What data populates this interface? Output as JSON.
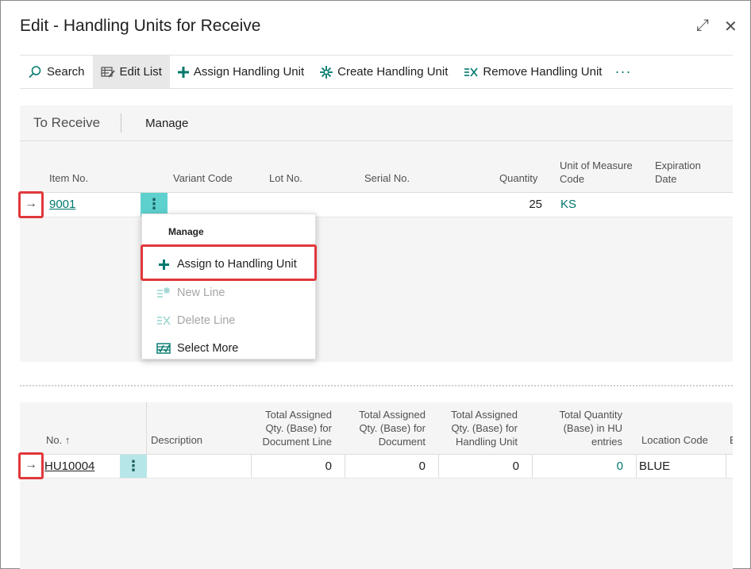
{
  "window": {
    "title": "Edit - Handling Units for Receive",
    "expand_icon": "⤢",
    "close_icon": "✕"
  },
  "toolbar": {
    "search_label": "Search",
    "edit_list_label": "Edit List",
    "assign_label": "Assign Handling Unit",
    "create_label": "Create Handling Unit",
    "remove_label": "Remove Handling Unit",
    "more_label": "···"
  },
  "to_receive": {
    "title": "To Receive",
    "manage_label": "Manage",
    "columns": {
      "item_no": "Item No.",
      "variant_code": "Variant Code",
      "lot_no": "Lot No.",
      "serial_no": "Serial No.",
      "quantity": "Quantity",
      "uom_line1": "Unit of Measure",
      "uom_line2": "Code",
      "exp_line1": "Expiration",
      "exp_line2": "Date"
    },
    "row": {
      "item_no": "9001",
      "quantity": "25",
      "uom": "KS"
    }
  },
  "context_menu": {
    "title": "Manage",
    "items": [
      {
        "label": "Assign to Handling Unit",
        "enabled": true
      },
      {
        "label": "New Line",
        "enabled": false
      },
      {
        "label": "Delete Line",
        "enabled": false
      },
      {
        "label": "Select More",
        "enabled": true
      }
    ]
  },
  "handling_units": {
    "columns": {
      "no": "No. ↑",
      "description": "Description",
      "doc_line_1": "Total Assigned",
      "doc_line_2": "Qty. (Base) for",
      "doc_line_3": "Document Line",
      "doc_1": "Total Assigned",
      "doc_2": "Qty. (Base) for",
      "doc_3": "Document",
      "hu_1": "Total Assigned",
      "hu_2": "Qty. (Base) for",
      "hu_3": "Handling Unit",
      "huq_1": "Total Quantity",
      "huq_2": "(Base) in HU",
      "huq_3": "entries",
      "location": "Location Code",
      "next": "B"
    },
    "row": {
      "no": "HU10004",
      "doc_line": "0",
      "doc": "0",
      "hu": "0",
      "hu_entries": "0",
      "location": "BLUE"
    }
  },
  "colors": {
    "accent": "#00786d",
    "highlight_red": "#e0383b",
    "dots_button": "#5ed1cf"
  },
  "row_arrow": "→"
}
